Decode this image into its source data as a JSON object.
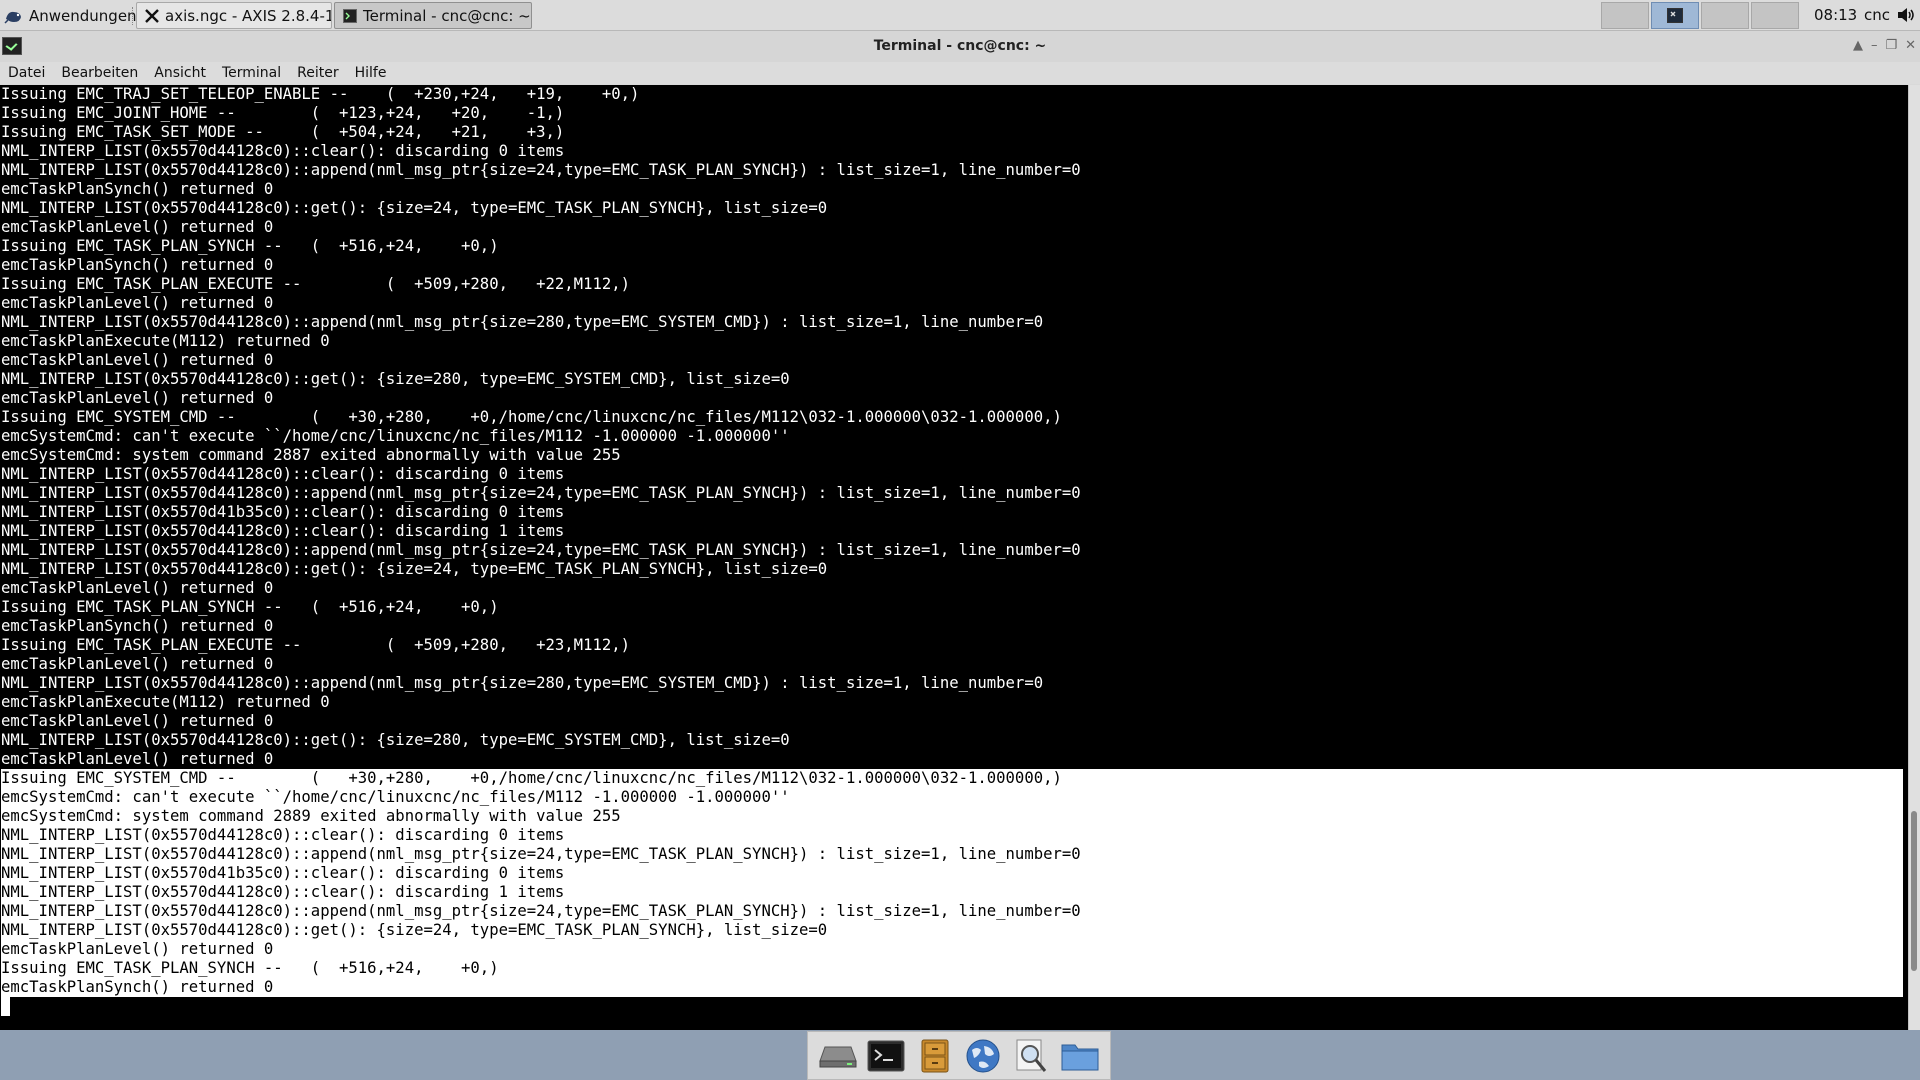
{
  "panel": {
    "app_menu": "Anwendungen",
    "tasks": [
      {
        "title": "axis.ngc - AXIS 2.8.4-1-...",
        "icon": "x-window-icon"
      },
      {
        "title": "Terminal - cnc@cnc: ~",
        "icon": "terminal-icon"
      }
    ],
    "clock": "08:13",
    "user": "cnc"
  },
  "window": {
    "title": "Terminal - cnc@cnc: ~",
    "menu": [
      "Datei",
      "Bearbeiten",
      "Ansicht",
      "Terminal",
      "Reiter",
      "Hilfe"
    ]
  },
  "terminal": {
    "lines": [
      "Issuing EMC_TRAJ_SET_TELEOP_ENABLE --    (  +230,+24,   +19,    +0,)",
      "Issuing EMC_JOINT_HOME --        (  +123,+24,   +20,    -1,)",
      "Issuing EMC_TASK_SET_MODE --     (  +504,+24,   +21,    +3,)",
      "NML_INTERP_LIST(0x5570d44128c0)::clear(): discarding 0 items",
      "NML_INTERP_LIST(0x5570d44128c0)::append(nml_msg_ptr{size=24,type=EMC_TASK_PLAN_SYNCH}) : list_size=1, line_number=0",
      "emcTaskPlanSynch() returned 0",
      "NML_INTERP_LIST(0x5570d44128c0)::get(): {size=24, type=EMC_TASK_PLAN_SYNCH}, list_size=0",
      "emcTaskPlanLevel() returned 0",
      "Issuing EMC_TASK_PLAN_SYNCH --   (  +516,+24,    +0,)",
      "emcTaskPlanSynch() returned 0",
      "Issuing EMC_TASK_PLAN_EXECUTE --         (  +509,+280,   +22,M112,)",
      "emcTaskPlanLevel() returned 0",
      "NML_INTERP_LIST(0x5570d44128c0)::append(nml_msg_ptr{size=280,type=EMC_SYSTEM_CMD}) : list_size=1, line_number=0",
      "emcTaskPlanExecute(M112) returned 0",
      "emcTaskPlanLevel() returned 0",
      "NML_INTERP_LIST(0x5570d44128c0)::get(): {size=280, type=EMC_SYSTEM_CMD}, list_size=0",
      "emcTaskPlanLevel() returned 0",
      "Issuing EMC_SYSTEM_CMD --        (   +30,+280,    +0,/home/cnc/linuxcnc/nc_files/M112\\032-1.000000\\032-1.000000,)",
      "emcSystemCmd: can't execute ``/home/cnc/linuxcnc/nc_files/M112 -1.000000 -1.000000''",
      "emcSystemCmd: system command 2887 exited abnormally with value 255",
      "NML_INTERP_LIST(0x5570d44128c0)::clear(): discarding 0 items",
      "NML_INTERP_LIST(0x5570d44128c0)::append(nml_msg_ptr{size=24,type=EMC_TASK_PLAN_SYNCH}) : list_size=1, line_number=0",
      "NML_INTERP_LIST(0x5570d41b35c0)::clear(): discarding 0 items",
      "NML_INTERP_LIST(0x5570d44128c0)::clear(): discarding 1 items",
      "NML_INTERP_LIST(0x5570d44128c0)::append(nml_msg_ptr{size=24,type=EMC_TASK_PLAN_SYNCH}) : list_size=1, line_number=0",
      "NML_INTERP_LIST(0x5570d44128c0)::get(): {size=24, type=EMC_TASK_PLAN_SYNCH}, list_size=0",
      "emcTaskPlanLevel() returned 0",
      "Issuing EMC_TASK_PLAN_SYNCH --   (  +516,+24,    +0,)",
      "emcTaskPlanSynch() returned 0",
      "Issuing EMC_TASK_PLAN_EXECUTE --         (  +509,+280,   +23,M112,)",
      "emcTaskPlanLevel() returned 0",
      "NML_INTERP_LIST(0x5570d44128c0)::append(nml_msg_ptr{size=280,type=EMC_SYSTEM_CMD}) : list_size=1, line_number=0",
      "emcTaskPlanExecute(M112) returned 0",
      "emcTaskPlanLevel() returned 0",
      "NML_INTERP_LIST(0x5570d44128c0)::get(): {size=280, type=EMC_SYSTEM_CMD}, list_size=0",
      "emcTaskPlanLevel() returned 0",
      "Issuing EMC_SYSTEM_CMD --        (   +30,+280,    +0,/home/cnc/linuxcnc/nc_files/M112\\032-1.000000\\032-1.000000,)",
      "emcSystemCmd: can't execute ``/home/cnc/linuxcnc/nc_files/M112 -1.000000 -1.000000''",
      "emcSystemCmd: system command 2889 exited abnormally with value 255",
      "NML_INTERP_LIST(0x5570d44128c0)::clear(): discarding 0 items",
      "NML_INTERP_LIST(0x5570d44128c0)::append(nml_msg_ptr{size=24,type=EMC_TASK_PLAN_SYNCH}) : list_size=1, line_number=0",
      "NML_INTERP_LIST(0x5570d41b35c0)::clear(): discarding 0 items",
      "NML_INTERP_LIST(0x5570d44128c0)::clear(): discarding 1 items",
      "NML_INTERP_LIST(0x5570d44128c0)::append(nml_msg_ptr{size=24,type=EMC_TASK_PLAN_SYNCH}) : list_size=1, line_number=0",
      "NML_INTERP_LIST(0x5570d44128c0)::get(): {size=24, type=EMC_TASK_PLAN_SYNCH}, list_size=0",
      "emcTaskPlanLevel() returned 0",
      "Issuing EMC_TASK_PLAN_SYNCH --   (  +516,+24,    +0,)",
      "emcTaskPlanSynch() returned 0"
    ],
    "highlight_start_index": 36,
    "scroll_position": 0.93
  },
  "dock": {
    "items": [
      "drive-icon",
      "terminal-icon",
      "file-cabinet-icon",
      "web-browser-icon",
      "search-app-icon",
      "folder-icon"
    ]
  },
  "colors": {
    "terminal_bg": "#000000",
    "terminal_fg": "#ffffff",
    "highlight_bg": "#ffffff",
    "desktop": "#8f9fb3"
  }
}
